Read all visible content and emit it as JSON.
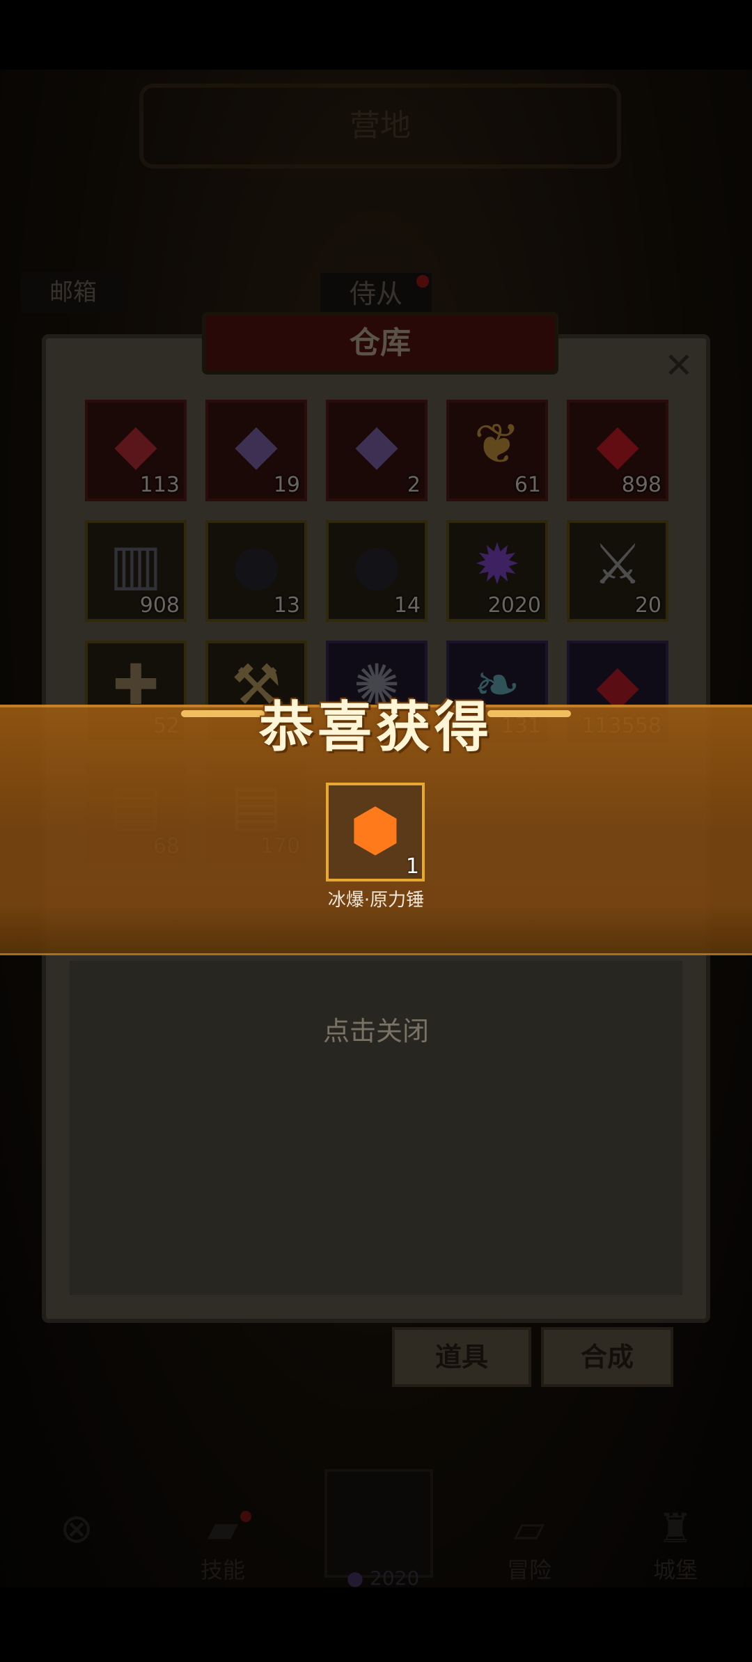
{
  "header": {
    "title": "营地"
  },
  "top_buttons": {
    "mail": "邮箱",
    "attendant": "侍从"
  },
  "warehouse": {
    "title": "仓库",
    "close_icon": "close-icon",
    "slots": [
      {
        "icon": "ruby-amulet-icon",
        "glyph": "◆",
        "color": "#c8323a",
        "count": "113",
        "tier": "red"
      },
      {
        "icon": "crystal-plus-icon",
        "glyph": "◆",
        "color": "#8a6ab8",
        "count": "19",
        "tier": "red"
      },
      {
        "icon": "crystal-icon",
        "glyph": "◆",
        "color": "#8a6ab8",
        "count": "2",
        "tier": "red"
      },
      {
        "icon": "golden-feather-icon",
        "glyph": "❦",
        "color": "#d8a040",
        "count": "61",
        "tier": "red"
      },
      {
        "icon": "red-gem-icon",
        "glyph": "◆",
        "color": "#d81e28",
        "count": "898",
        "tier": "red"
      },
      {
        "icon": "spellbook-icon",
        "glyph": "▥",
        "color": "#6a6e78",
        "count": "908",
        "tier": "gold"
      },
      {
        "icon": "ore-plus-icon",
        "glyph": "●",
        "color": "#2a2c34",
        "count": "13",
        "tier": "gold"
      },
      {
        "icon": "ore-icon",
        "glyph": "●",
        "color": "#2a2c34",
        "count": "14",
        "tier": "gold"
      },
      {
        "icon": "purple-flame-icon",
        "glyph": "✹",
        "color": "#8a4ad8",
        "count": "2020",
        "tier": "gold"
      },
      {
        "icon": "crossed-swords-coin-icon",
        "glyph": "⚔",
        "color": "#a8a8a8",
        "count": "20",
        "tier": "gold"
      },
      {
        "icon": "compass-amulet-icon",
        "glyph": "✚",
        "color": "#a89068",
        "count": "52",
        "tier": "gold"
      },
      {
        "icon": "hammer-icon",
        "glyph": "⚒",
        "color": "#c8a868",
        "count": "",
        "tier": "gold"
      },
      {
        "icon": "rune-disc-icon",
        "glyph": "✺",
        "color": "#9a9aa8",
        "count": "",
        "tier": "purple"
      },
      {
        "icon": "feather-quill-icon",
        "glyph": "❧",
        "color": "#6ab8c8",
        "count": "131",
        "tier": "purple"
      },
      {
        "icon": "red-crystal-cluster-icon",
        "glyph": "◆",
        "color": "#c81e28",
        "count": "113558",
        "tier": "purple"
      },
      {
        "icon": "scroll-icon",
        "glyph": "▤",
        "color": "#a8784a",
        "count": "68",
        "tier": "faded"
      },
      {
        "icon": "map-scroll-icon",
        "glyph": "▤",
        "color": "#b8a888",
        "count": "170",
        "tier": "faded"
      }
    ]
  },
  "reward": {
    "title": "恭喜获得",
    "item": {
      "icon": "rune-hammer-stone-icon",
      "glyph": "⬢",
      "name": "冰爆·原力锤",
      "count": "1"
    },
    "tap_to_close": "点击关闭"
  },
  "panel_buttons": {
    "items": "道具",
    "craft": "合成"
  },
  "bottom_nav": {
    "items": [
      {
        "icon": "close-circle-icon",
        "glyph": "⊗",
        "label": ""
      },
      {
        "icon": "skill-map-icon",
        "glyph": "▰",
        "label": "技能"
      },
      {
        "icon": "adventure-map-icon",
        "glyph": "▱",
        "label": "冒险"
      },
      {
        "icon": "castle-icon",
        "glyph": "♜",
        "label": "城堡"
      }
    ],
    "center_count": "2020",
    "center_icon": "purple-gem-icon"
  }
}
